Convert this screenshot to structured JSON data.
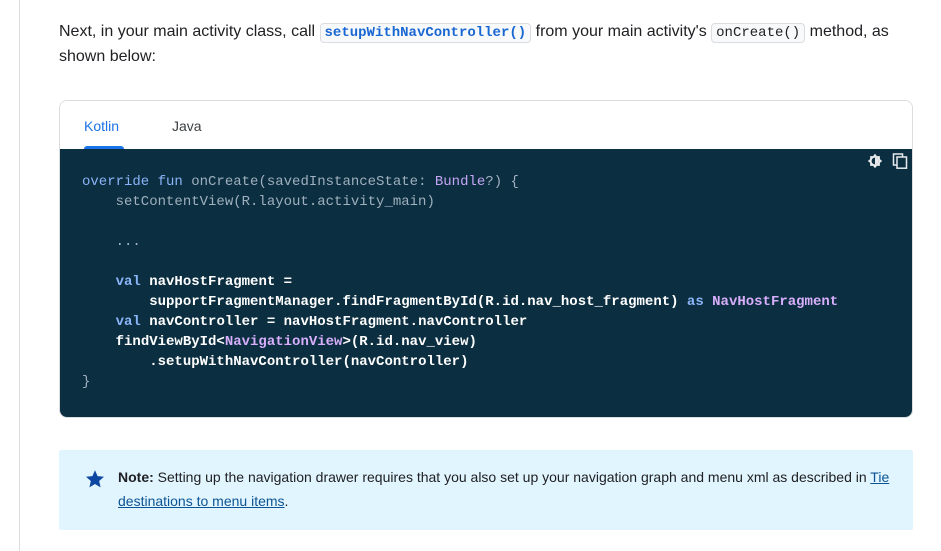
{
  "intro": {
    "before": "Next, in your main activity class, call ",
    "code1": "setupWithNavController()",
    "middle": " from your main activity's ",
    "code2": "onCreate()",
    "after": " method, as shown below:"
  },
  "tabs": [
    {
      "label": "Kotlin",
      "active": true
    },
    {
      "label": "Java",
      "active": false
    }
  ],
  "toolbar": {
    "theme_icon": "dark-mode-icon",
    "copy_icon": "copy-icon"
  },
  "code": {
    "l1_kw": "override fun",
    "l1_rest": " onCreate(savedInstanceState: ",
    "l1_type": "Bundle",
    "l1_end": "?) {",
    "l2": "    setContentView(R.layout.activity_main)",
    "l4": "    ...",
    "l6_kw": "val",
    "l6_rest": " navHostFragment =",
    "l7_a": "supportFragmentManager.findFragmentById(R.id.nav_host_",
    "l7_b": "fragment) ",
    "l7_as": "as",
    "l7_type": "NavHostFragment",
    "l8_kw": "val",
    "l8_rest": " navController = navHostFragment.navController",
    "l9_a": "findViewById<",
    "l9_type": "NavigationView",
    "l9_b": ">(R.id.nav_view)",
    "l10": ".setupWithNavController(navController)",
    "l11": "}"
  },
  "note": {
    "label": "Note:",
    "text": " Setting up the navigation drawer requires that you also set up your navigation graph and menu xml as described in ",
    "link": "Tie destinations to menu items",
    "end": "."
  },
  "colors": {
    "code_bg": "#0b2e40",
    "accent": "#1a73e8",
    "note_bg": "#e1f5fe"
  }
}
